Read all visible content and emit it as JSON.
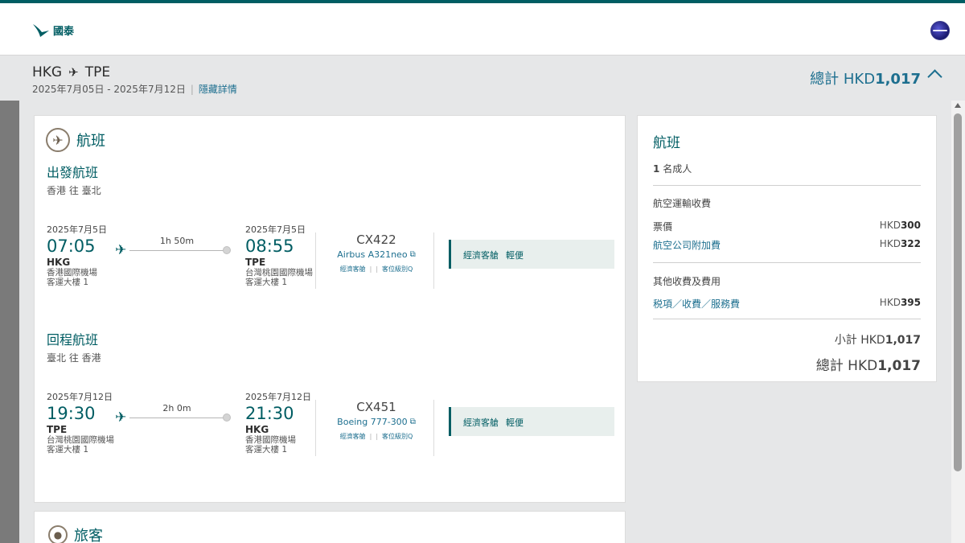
{
  "brand": {
    "name": "國泰",
    "logo_icon": "brushwing-icon",
    "accent": "#005d63",
    "link": "#1d6f8f"
  },
  "header": {
    "language_icon": "globe-icon"
  },
  "trip": {
    "origin": "HKG",
    "destination": "TPE",
    "route_icon": "plane-icon",
    "dates": "2025年7月05日 - 2025年7月12日",
    "hide_details": "隱藏詳情",
    "total_label": "總計 HKD",
    "total_amount": "1,017"
  },
  "flights_section": {
    "title": "航班",
    "icon": "airplane-circle-icon",
    "legs": [
      {
        "title": "出發航班",
        "subtitle": "香港 往 臺北",
        "dep_date": "2025年7月5日",
        "dep_time": "07:05",
        "dep_code": "HKG",
        "dep_airport": "香港國際機場",
        "dep_terminal": "客運大樓 1",
        "duration": "1h 50m",
        "arr_date": "2025年7月5日",
        "arr_time": "08:55",
        "arr_code": "TPE",
        "arr_airport": "台灣桃園國際機場",
        "arr_terminal": "客運大樓 1",
        "flight_no": "CX422",
        "aircraft": "Airbus A321neo",
        "cabin_link": "經濟客艙",
        "booking_class": "客位級別Q",
        "fare_cabin": "經濟客艙",
        "fare_brand": "輕便"
      },
      {
        "title": "回程航班",
        "subtitle": "臺北 往 香港",
        "dep_date": "2025年7月12日",
        "dep_time": "19:30",
        "dep_code": "TPE",
        "dep_airport": "台灣桃園國際機場",
        "dep_terminal": "客運大樓 1",
        "duration": "2h 0m",
        "arr_date": "2025年7月12日",
        "arr_time": "21:30",
        "arr_code": "HKG",
        "arr_airport": "香港國際機場",
        "arr_terminal": "客運大樓 1",
        "flight_no": "CX451",
        "aircraft": "Boeing 777-300",
        "cabin_link": "經濟客艙",
        "booking_class": "客位級別Q",
        "fare_cabin": "經濟客艙",
        "fare_brand": "輕便"
      }
    ]
  },
  "passengers_section": {
    "title": "旅客",
    "icon": "person-circle-icon"
  },
  "price_summary": {
    "title": "航班",
    "pax_count": "1",
    "pax_label": "名成人",
    "air_charges_label": "航空運輸收費",
    "fare_label": "票價",
    "fare_currency": "HKD",
    "fare_amount": "300",
    "surcharge_label": "航空公司附加費",
    "surcharge_currency": "HKD",
    "surcharge_amount": "322",
    "other_label": "其他收費及費用",
    "taxes_label": "税項／收費／服務費",
    "taxes_currency": "HKD",
    "taxes_amount": "395",
    "subtotal_label": "小計 HKD",
    "subtotal_amount": "1,017",
    "total_label": "總計 HKD",
    "total_amount": "1,017"
  }
}
